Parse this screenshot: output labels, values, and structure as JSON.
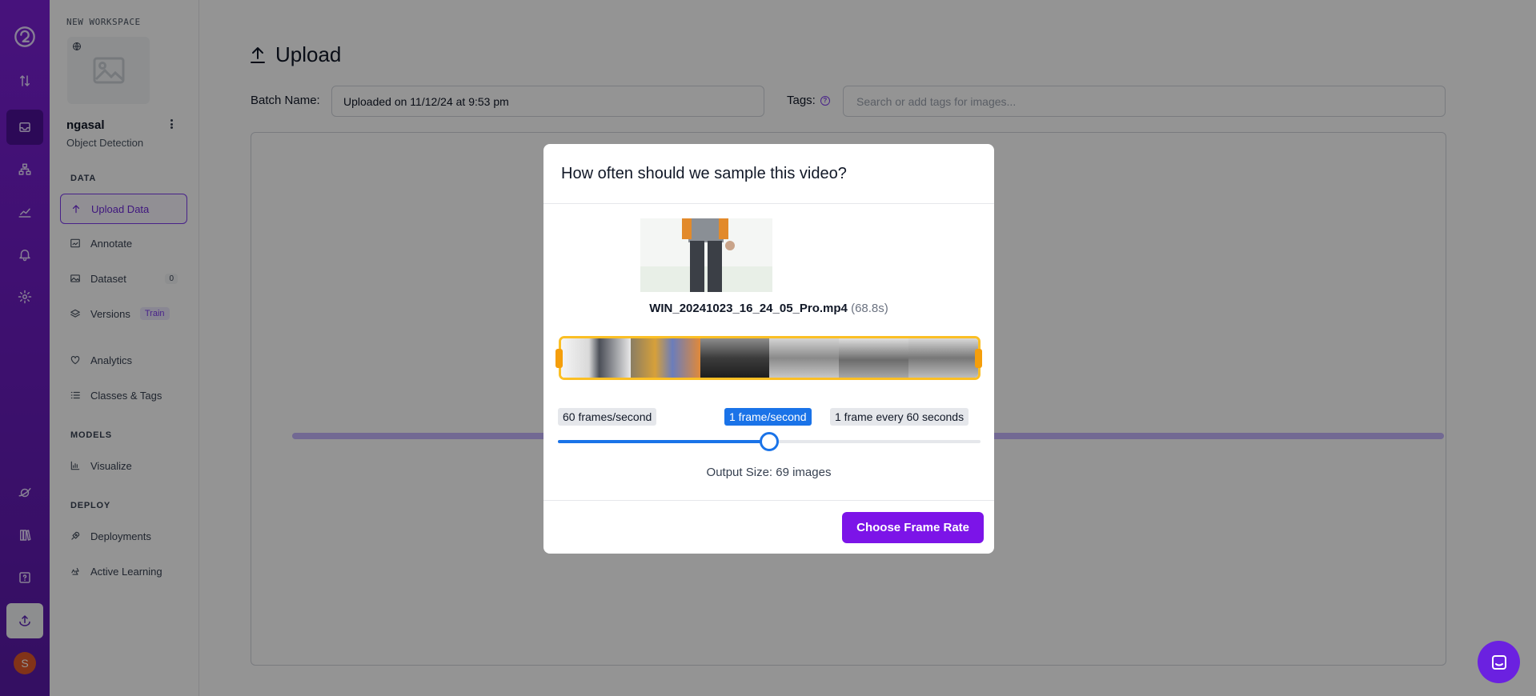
{
  "colors": {
    "brand": "#7c14e8",
    "rail": "#7b1fd6",
    "slider": "#1a73e8",
    "filmstrip_border": "#fbbf24"
  },
  "rail": {
    "icons": [
      "logo-icon",
      "arrows-updown-icon",
      "inbox-icon",
      "workflow-icon",
      "chart-icon",
      "bell-icon",
      "gear-icon",
      "planet-icon",
      "book-icon",
      "help-icon",
      "upload-icon"
    ],
    "avatar_initial": "S"
  },
  "sidebar": {
    "workspace_label": "NEW WORKSPACE",
    "project_name": "ngasal",
    "project_type": "Object Detection",
    "sections": {
      "data": "DATA",
      "models": "MODELS",
      "deploy": "DEPLOY"
    },
    "items": [
      {
        "label": "Upload Data",
        "icon": "arrow-up-icon",
        "active": true
      },
      {
        "label": "Annotate",
        "icon": "annotate-icon"
      },
      {
        "label": "Dataset",
        "icon": "image-icon",
        "count": "0"
      },
      {
        "label": "Versions",
        "icon": "layers-icon",
        "badge": "Train"
      },
      {
        "label": "Analytics",
        "icon": "analytics-icon"
      },
      {
        "label": "Classes & Tags",
        "icon": "list-icon"
      },
      {
        "label": "Visualize",
        "icon": "visualize-icon"
      },
      {
        "label": "Deployments",
        "icon": "rocket-icon"
      },
      {
        "label": "Active Learning",
        "icon": "recycle-icon"
      }
    ]
  },
  "main": {
    "title": "Upload",
    "batch_label": "Batch Name:",
    "batch_value": "Uploaded on 11/12/24 at 9:53 pm",
    "tags_label": "Tags:",
    "tags_placeholder": "Search or add tags for images..."
  },
  "modal": {
    "title": "How often should we sample this video?",
    "filename": "WIN_20241023_16_24_05_Pro.mp4",
    "duration": "(68.8s)",
    "rate_options": [
      "60 frames/second",
      "1 frame/second",
      "1 frame every 60 seconds"
    ],
    "selected_rate": "1 frame/second",
    "slider_fraction": 0.5,
    "output_size": "Output Size: 69 images",
    "button": "Choose Frame Rate"
  }
}
